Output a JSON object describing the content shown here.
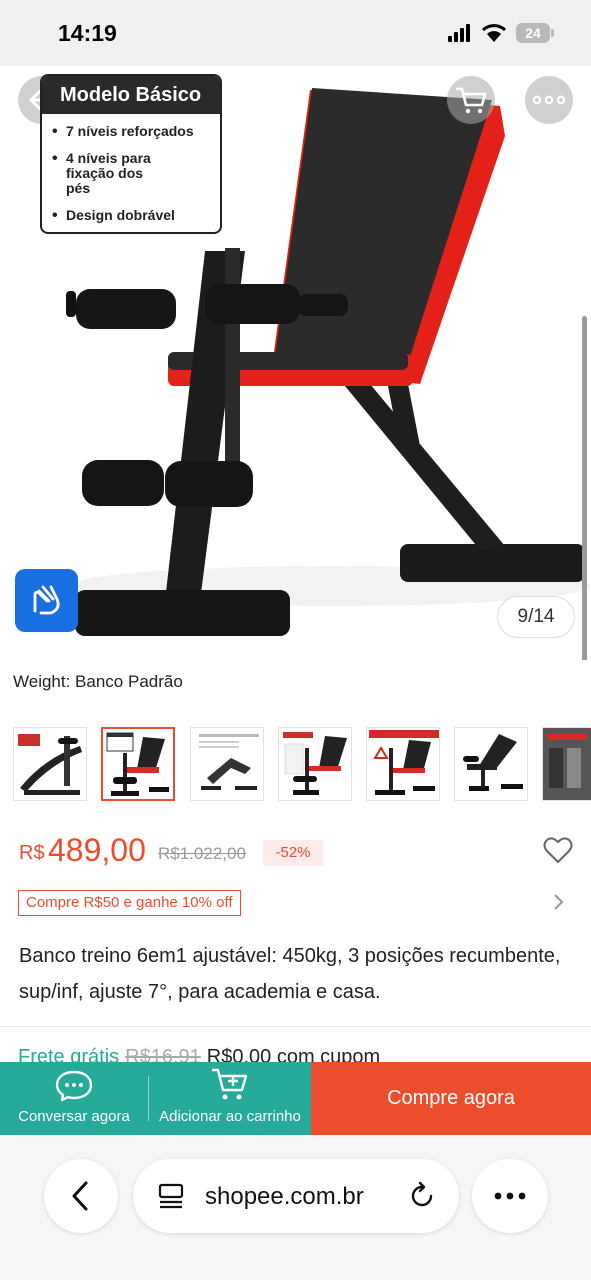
{
  "status_bar": {
    "time": "14:19",
    "battery": "24"
  },
  "gallery": {
    "callout": {
      "title": "Modelo Básico",
      "features": [
        "7 níveis reforçados",
        "4 níveis para fixação dos pés",
        "Design dobrável"
      ]
    },
    "counter": "9/14"
  },
  "variant": {
    "label": "Weight: Banco Padrão"
  },
  "pricing": {
    "currency": "R$",
    "price": "489,00",
    "original_price": "R$1.022,00",
    "discount": "-52%"
  },
  "promo": {
    "text": "Compre R$50 e ganhe 10% off"
  },
  "product": {
    "title": "Banco treino 6em1 ajustável: 450kg, 3 posições recumbente, sup/inf, ajuste 7°, para academia e casa."
  },
  "shipping": {
    "free_label": "Frete grátis",
    "old_price": "R$16,91",
    "new_text": "R$0,00 com cupom"
  },
  "actions": {
    "chat_label": "Conversar agora",
    "cart_label": "Adicionar ao carrinho",
    "buy_label": "Compre agora"
  },
  "browser": {
    "url": "shopee.com.br"
  },
  "colors": {
    "accent": "#ee4d2d",
    "teal": "#26aa99",
    "bench_red": "#e32119"
  }
}
